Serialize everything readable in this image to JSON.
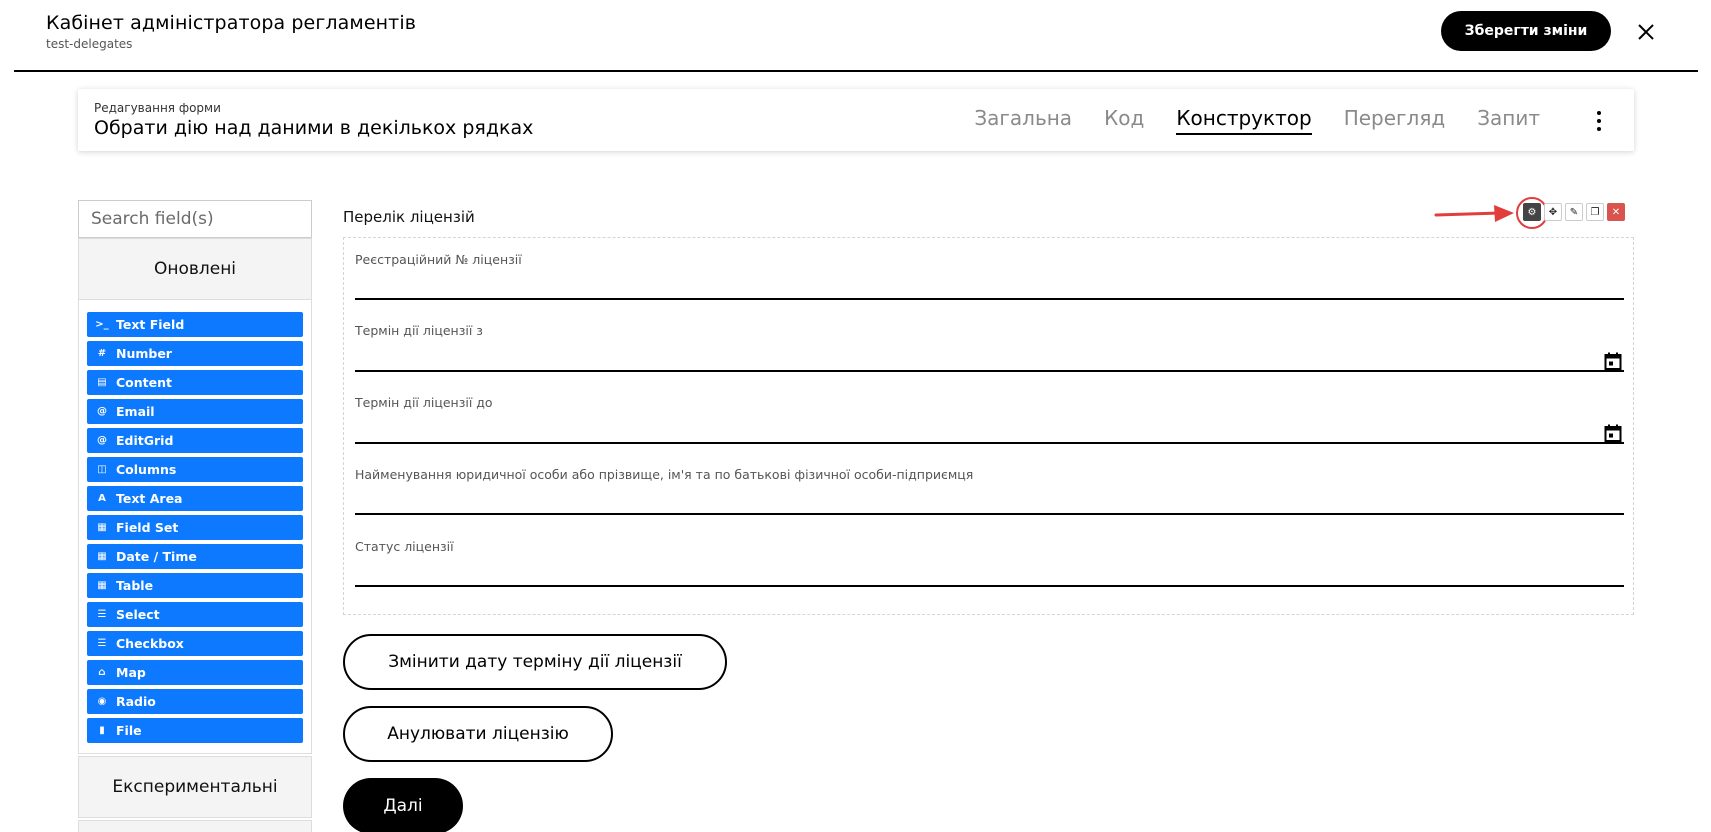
{
  "header": {
    "title": "Кабінет адміністратора регламентів",
    "subtitle": "test-delegates",
    "save_label": "Зберегти зміни"
  },
  "form_card": {
    "label": "Редагування форми",
    "title": "Обрати дію над даними в декількох рядках",
    "tabs": [
      {
        "label": "Загальна",
        "active": false
      },
      {
        "label": "Код",
        "active": false
      },
      {
        "label": "Конструктор",
        "active": true
      },
      {
        "label": "Перегляд",
        "active": false
      },
      {
        "label": "Запит",
        "active": false
      }
    ]
  },
  "sidebar": {
    "search_placeholder": "Search field(s)",
    "group_updated": "Оновлені",
    "group_experimental": "Експериментальні",
    "items": [
      {
        "label": "Text Field",
        "icon": "terminal-icon"
      },
      {
        "label": "Number",
        "icon": "hash-icon"
      },
      {
        "label": "Content",
        "icon": "document-icon"
      },
      {
        "label": "Email",
        "icon": "at-icon"
      },
      {
        "label": "EditGrid",
        "icon": "at-icon"
      },
      {
        "label": "Columns",
        "icon": "columns-icon"
      },
      {
        "label": "Text Area",
        "icon": "font-icon"
      },
      {
        "label": "Field Set",
        "icon": "grid-icon"
      },
      {
        "label": "Date / Time",
        "icon": "calendar-icon"
      },
      {
        "label": "Table",
        "icon": "table-icon"
      },
      {
        "label": "Select",
        "icon": "list-icon"
      },
      {
        "label": "Checkbox",
        "icon": "list-icon"
      },
      {
        "label": "Map",
        "icon": "home-icon"
      },
      {
        "label": "Radio",
        "icon": "radio-icon"
      },
      {
        "label": "File",
        "icon": "file-icon"
      }
    ]
  },
  "panel": {
    "title": "Перелік ліцензій",
    "fields": [
      {
        "label": "Реєстраційний № ліцензії",
        "has_calendar": false
      },
      {
        "label": "Термін дії ліцензії з",
        "has_calendar": true
      },
      {
        "label": "Термін дії ліцензії до",
        "has_calendar": true
      },
      {
        "label": "Найменування юридичної особи або прізвище, ім'я та по батькові фізичної особи-підприємця",
        "has_calendar": false
      },
      {
        "label": "Статус ліцензії",
        "has_calendar": false
      }
    ]
  },
  "actions": {
    "change_date": "Змінити дату терміну дії ліцензії",
    "cancel_license": "Анулювати ліцензію",
    "next": "Далі"
  },
  "colors": {
    "accent_blue": "#0d79ff",
    "annotation_red": "#e23d3d",
    "delete_red": "#d9534f"
  }
}
